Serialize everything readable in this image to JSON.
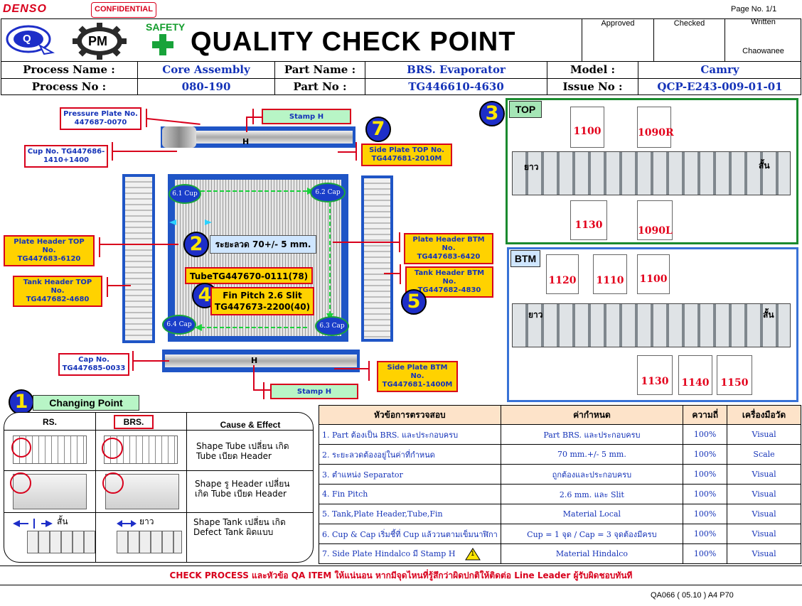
{
  "header": {
    "brand": "DENSO",
    "confidential": "CONFIDENTIAL",
    "page_no": "Page No. 1/1",
    "logo_q": "Q",
    "logo_pm": "PM",
    "safety": "SAFETY",
    "title": "QUALITY CHECK POINT",
    "approved_label": "Approved",
    "checked_label": "Checked",
    "written_label": "Written",
    "written_by": "Chaowanee"
  },
  "info": {
    "process_name_label": "Process Name :",
    "process_name": "Core Assembly",
    "part_name_label": "Part Name :",
    "part_name": "BRS. Evaporator",
    "model_label": "Model :",
    "model": "Camry",
    "process_no_label": "Process No :",
    "process_no": "080-190",
    "part_no_label": "Part No :",
    "part_no": "TG446610-4630",
    "issue_no_label": "Issue No :",
    "issue_no": "QCP-E243-009-01-01"
  },
  "diagram": {
    "pressure_plate": "Pressure Plate No.\n447687-0070",
    "stamp_h_top": "Stamp H",
    "h_mark_top": "H",
    "cup_no": "Cup No. TG447686-\n1410+1400",
    "side_plate_top": "Side Plate TOP No.\nTG447681-2010M",
    "badge_7": "7",
    "cap_61": "6.1 Cup",
    "cap_62": "6.2 Cap",
    "cap_63": "6.3 Cap",
    "cap_64": "6.4 Cap",
    "badge_2": "2",
    "wire_dist": "ระยะลวด 70+/- 5 mm.",
    "plate_header_top": "Plate Header TOP No.\nTG447683-6120",
    "plate_header_btm": "Plate Header BTM No.\nTG447683-6420",
    "tube": "TubeTG447670-0111(78)",
    "badge_4": "4",
    "fin_pitch": "Fin Pitch 2.6 Slit\nTG447673-2200(40)",
    "tank_header_top": "Tank Header TOP No.\nTG447682-4680",
    "tank_header_btm": "Tank Header BTM No.\nTG447682-4830",
    "badge_5": "5",
    "cap_no": "Cap No.\nTG447685-0033",
    "h_mark_btm": "H",
    "side_plate_btm": "Side Plate BTM No.\nTG447681-1400M",
    "stamp_h_btm": "Stamp H"
  },
  "top_section": {
    "badge": "3",
    "tag": "TOP",
    "long_label": "ยาว",
    "short_label": "สั้น",
    "plates_upper": [
      "1100",
      "1090R"
    ],
    "plates_lower": [
      "1130",
      "1090L"
    ]
  },
  "btm_section": {
    "tag": "BTM",
    "long_label": "ยาว",
    "short_label": "สั้น",
    "plates_upper": [
      "1120",
      "1110",
      "1100"
    ],
    "plates_lower": [
      "1130",
      "1140",
      "1150"
    ]
  },
  "changing_point": {
    "badge": "1",
    "title": "Changing Point",
    "col_rs": "RS.",
    "col_brs": "BRS.",
    "col_cause": "Cause & Effect",
    "rows": [
      {
        "cause": "Shape Tube เปลี่ยน เกิด\nTube เบียด Header"
      },
      {
        "cause": "Shape รู Header เปลี่ยน\nเกิด Tube เบียด Header"
      },
      {
        "cause": "Shape Tank เปลี่ยน เกิด\nDefect Tank ผิดแบบ"
      }
    ],
    "short_label": "สั้น",
    "long_label": "ยาว"
  },
  "check_table": {
    "headers": [
      "หัวข้อการตรวจสอบ",
      "ค่ากำหนด",
      "ความถี่",
      "เครื่องมือวัด"
    ],
    "rows": [
      {
        "item": "1. Part ต้องเป็น BRS. และประกอบครบ",
        "spec": "Part BRS. และประกอบครบ",
        "freq": "100%",
        "tool": "Visual"
      },
      {
        "item": "2. ระยะลวดต้องอยู่ในค่าที่กำหนด",
        "spec": "70 mm.+/- 5 mm.",
        "freq": "100%",
        "tool": "Scale"
      },
      {
        "item": "3. ตำแหน่ง Separator",
        "spec": "ถูกต้องและประกอบครบ",
        "freq": "100%",
        "tool": "Visual"
      },
      {
        "item": "4. Fin Pitch",
        "spec": "2.6 mm. และ Slit",
        "freq": "100%",
        "tool": "Visual"
      },
      {
        "item": "5. Tank,Plate Header,Tube,Fin",
        "spec": "Material Local",
        "freq": "100%",
        "tool": "Visual"
      },
      {
        "item": "6. Cup & Cap เริ่มชี้ที่ Cup แล้ววนตามเข็มนาฬิกา",
        "spec": "Cup = 1 จุด / Cap = 3 จุดต้องมีครบ",
        "freq": "100%",
        "tool": "Visual"
      },
      {
        "item": "7. Side Plate Hindalco มี Stamp H",
        "spec": "Material Hindalco",
        "freq": "100%",
        "tool": "Visual"
      }
    ],
    "warn_badge": "1"
  },
  "footer": {
    "message": "CHECK PROCESS และหัวข้อ QA ITEM ให้แน่นอน หากมีจุดไหนที่รู้สึกว่าผิดปกติให้ติดต่อ Line Leader ผู้รับผิดชอบทันที",
    "form_code": "QA066 ( 05.10 ) A4 P70"
  }
}
